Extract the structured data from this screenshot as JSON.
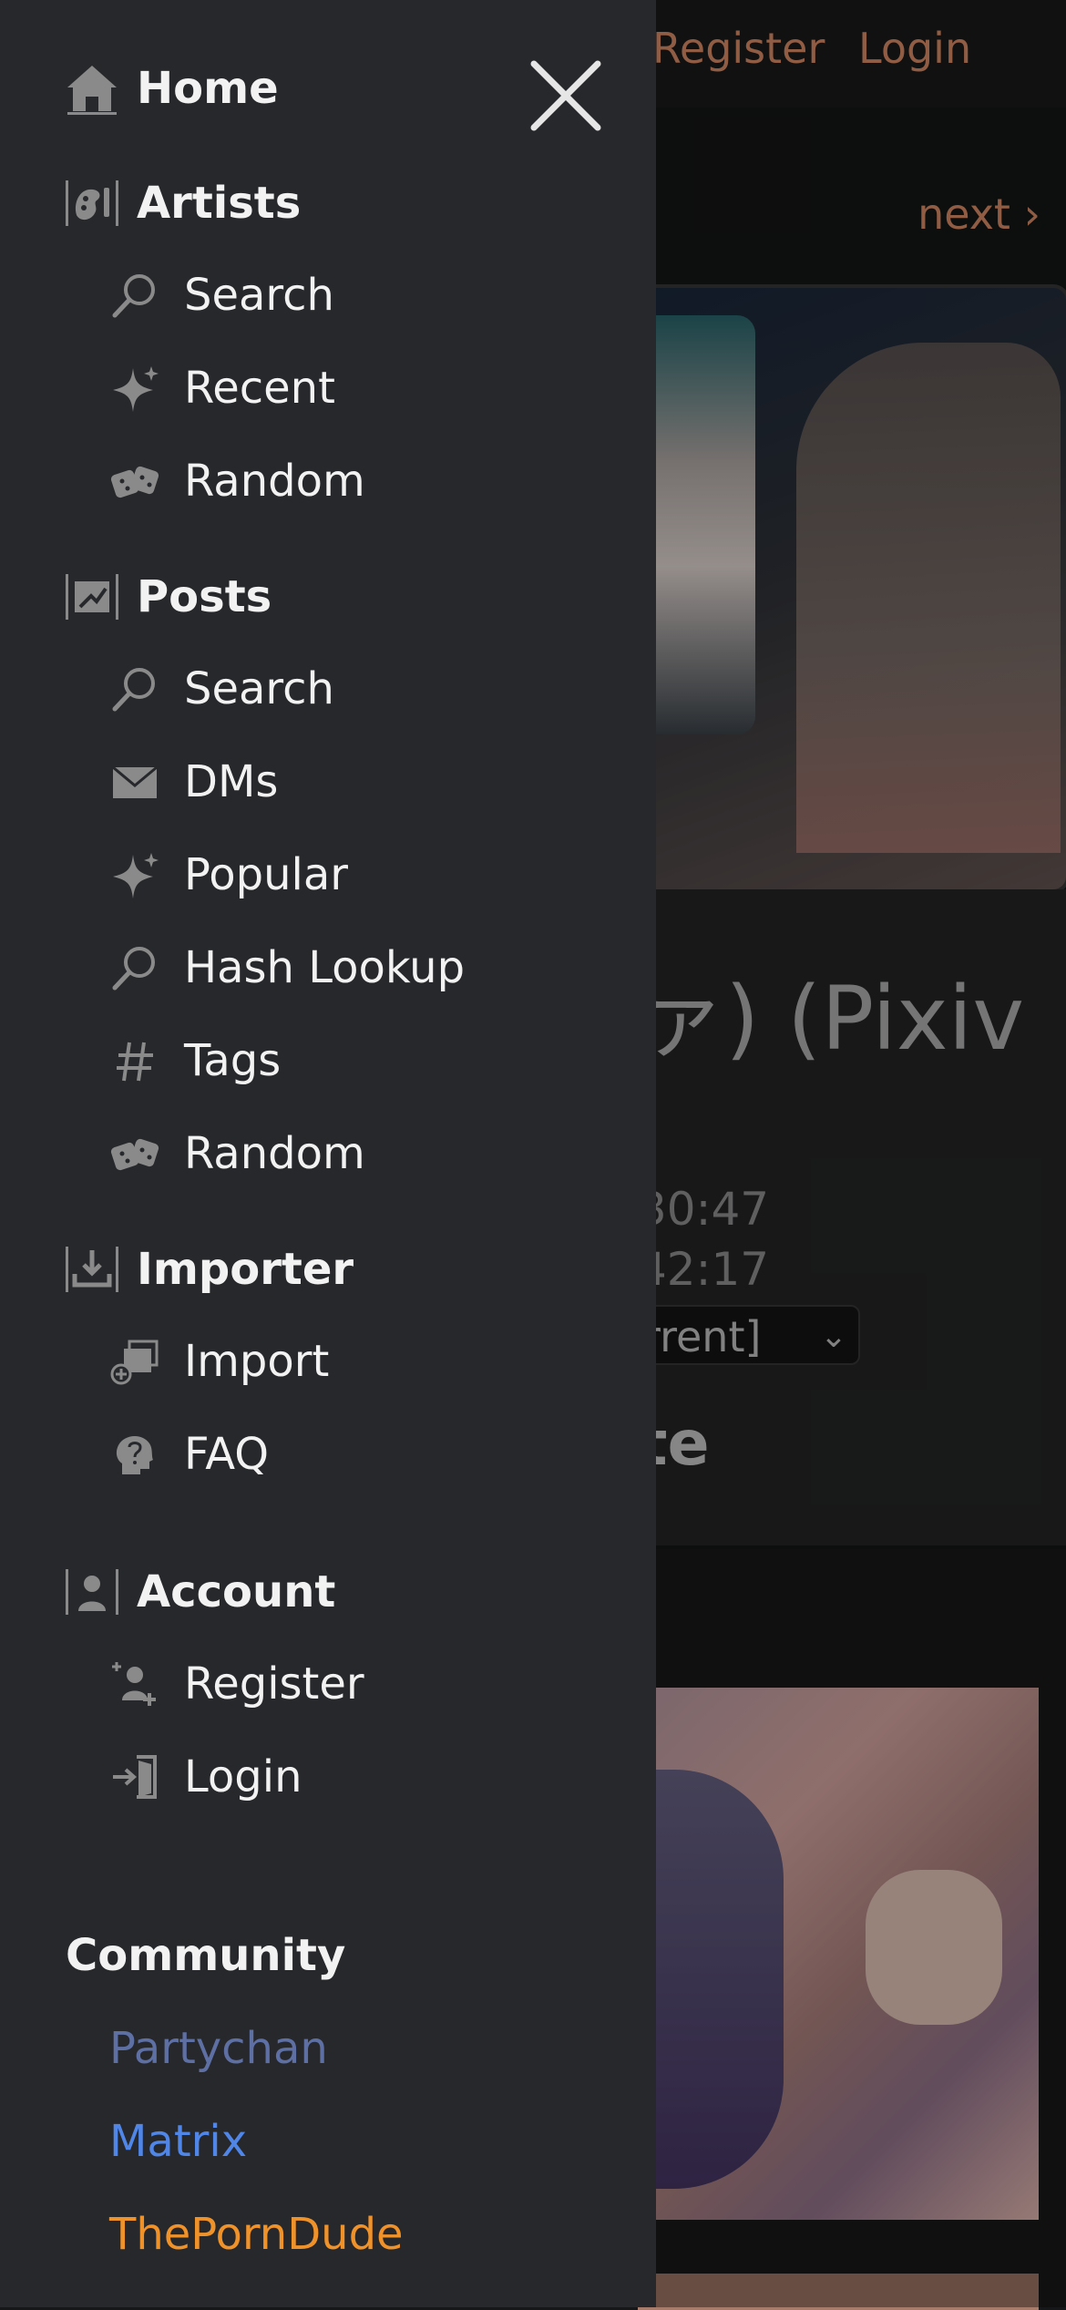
{
  "topbar": {
    "register": "Register",
    "login": "Login"
  },
  "pager": {
    "next": "next ›"
  },
  "post": {
    "title_fragment": "ァ) (Pixiv",
    "time1": "30:47",
    "time2": "42:17",
    "select_value": "rrent]",
    "bold_fragment": "te"
  },
  "drawer": {
    "home": "Home",
    "artists": {
      "label": "Artists",
      "items": [
        "Search",
        "Recent",
        "Random"
      ]
    },
    "posts": {
      "label": "Posts",
      "items": [
        "Search",
        "DMs",
        "Popular",
        "Hash Lookup",
        "Tags",
        "Random"
      ]
    },
    "importer": {
      "label": "Importer",
      "items": [
        "Import",
        "FAQ"
      ]
    },
    "account": {
      "label": "Account",
      "items": [
        "Register",
        "Login"
      ]
    },
    "community": {
      "label": "Community",
      "links": [
        {
          "label": "Partychan",
          "color": "#5e6fa3"
        },
        {
          "label": "Matrix",
          "color": "#4f86e8"
        },
        {
          "label": "ThePornDude",
          "color": "#f0922a"
        }
      ]
    }
  }
}
